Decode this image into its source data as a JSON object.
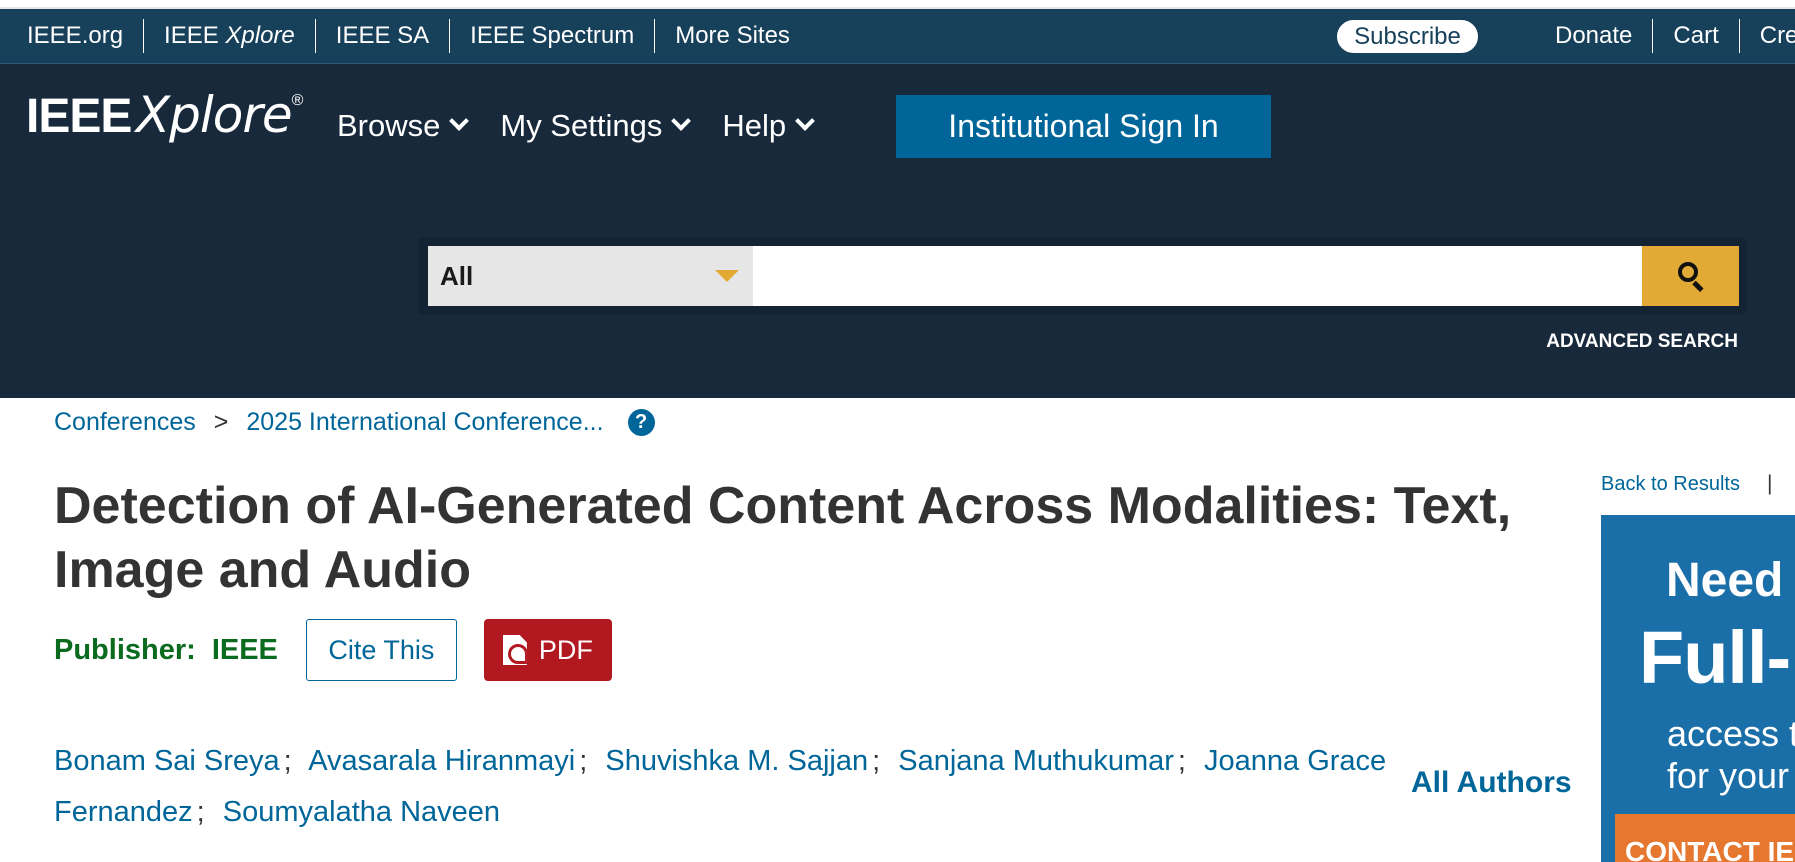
{
  "meta_bar": {
    "links": [
      "IEEE.org",
      "IEEE ",
      "IEEE SA",
      "IEEE Spectrum",
      "More Sites"
    ],
    "xplore_italic": "Xplore",
    "subscribe": "Subscribe",
    "right_links": [
      "Donate",
      "Cart",
      "Crea"
    ]
  },
  "header": {
    "logo_ieee": "IEEE",
    "logo_xplore": "Xplore",
    "logo_reg": "®",
    "nav": [
      "Browse",
      "My Settings",
      "Help"
    ],
    "signin": "Institutional Sign In"
  },
  "search": {
    "scope": "All",
    "value": "",
    "advanced": "ADVANCED SEARCH"
  },
  "breadcrumb": {
    "items": [
      "Conferences",
      "2025 International Conference..."
    ],
    "separator": ">",
    "help": "?"
  },
  "article": {
    "title": "Detection of AI-Generated Content Across Modalities: Text, Image and Audio",
    "publisher_label": "Publisher:",
    "publisher": "IEEE",
    "cite": "Cite This",
    "pdf": "PDF",
    "authors": [
      "Bonam Sai Sreya",
      "Avasarala Hiranmayi",
      "Shuvishka M. Sajjan",
      "Sanjana Muthukumar",
      "Joanna Grace Fernandez",
      "Soumyalatha Naveen"
    ],
    "author_sep": ";",
    "all_authors": "All Authors"
  },
  "sidebar": {
    "back": "Back to Results",
    "sep": "|"
  },
  "ad": {
    "line1": "Need",
    "line2": "Full-",
    "line3": "access t",
    "line4": "for your",
    "button": "CONTACT IE"
  },
  "colors": {
    "meta_bar": "#17405a",
    "header": "#17293b",
    "link": "#006699",
    "publisher": "#0a6b1f",
    "pdf": "#b2181f",
    "search_button": "#e2a934"
  }
}
